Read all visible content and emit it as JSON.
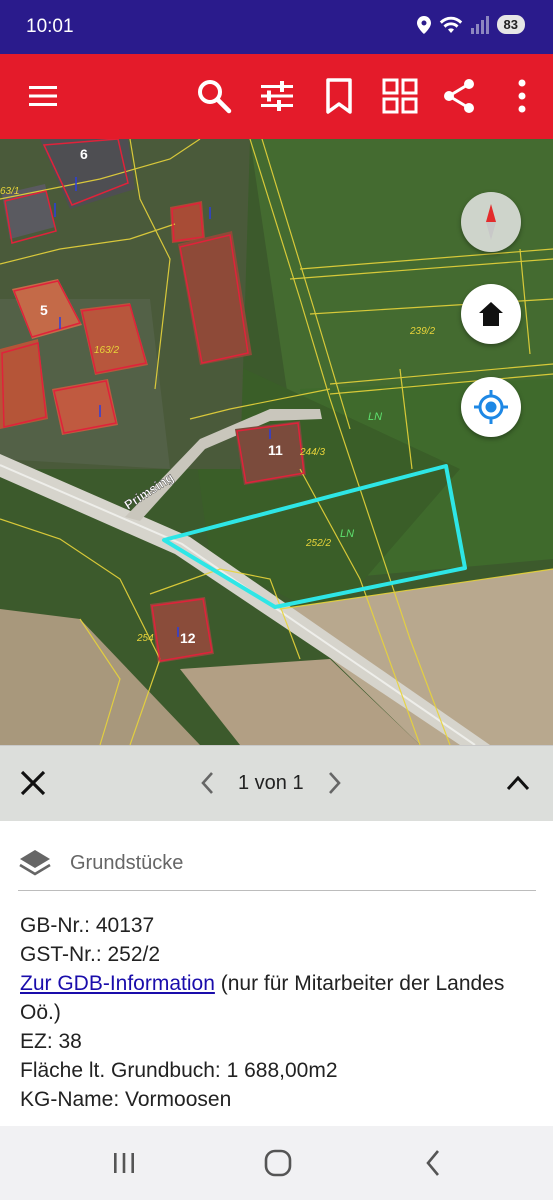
{
  "status_bar": {
    "time": "10:01",
    "battery": "83",
    "icons": [
      "location-icon",
      "wifi-icon",
      "signal-icon",
      "battery-icon"
    ]
  },
  "app_bar": {
    "color": "#e41b2a",
    "icons": [
      "menu-icon",
      "search-icon",
      "filter-icon",
      "bookmark-icon",
      "grid-icon",
      "share-icon",
      "more-icon"
    ]
  },
  "map": {
    "house_numbers": [
      "6",
      "5",
      "11",
      "12"
    ],
    "parcel_labels": [
      "63/1",
      "163/2",
      "244/3",
      "239/2",
      "252/2",
      "254"
    ],
    "land_use_labels": [
      "LN",
      "LN"
    ],
    "street_name": "Primsing",
    "buttons": [
      "compass-icon",
      "home-icon",
      "my-location-icon"
    ],
    "selection_color": "#2ee6e6"
  },
  "sheet": {
    "pager": "1 von 1",
    "layer_label": "Grundstücke",
    "gb_nr": "GB-Nr.: 40137",
    "gst_nr": "GST-Nr.: 252/2",
    "link_text": "Zur GDB-Information",
    "link_suffix": " (nur für Mitarbeiter der Landes Oö.)",
    "ez": "EZ: 38",
    "flaeche": "Fläche lt. Grundbuch: 1 688,00m2",
    "kg_name": "KG-Name: Vormoosen"
  },
  "nav_bar": {
    "icons": [
      "recents-icon",
      "home-circle-icon",
      "back-icon"
    ]
  }
}
